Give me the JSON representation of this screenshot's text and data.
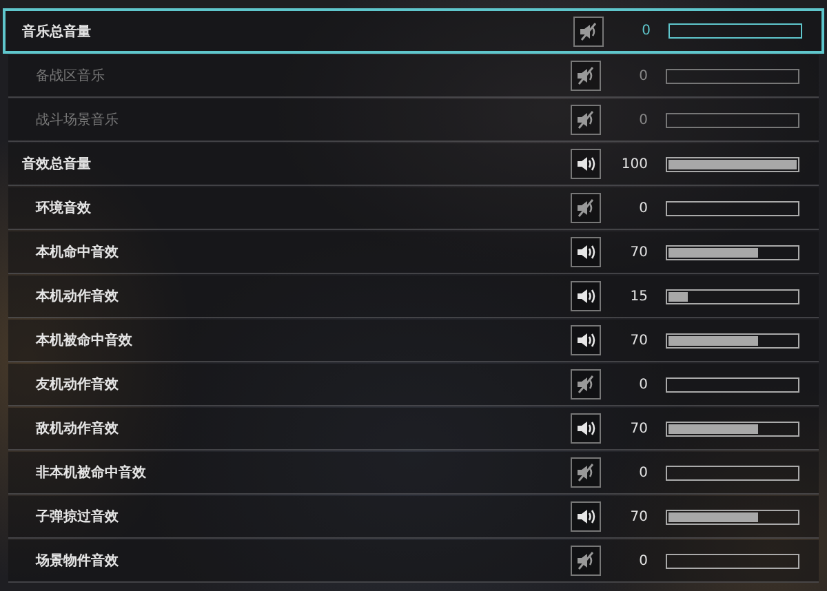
{
  "groups": [
    {
      "name": "音乐总音量",
      "reading": "0",
      "muted": true,
      "disabled": false,
      "selected": true,
      "children": [
        {
          "name": "备战区音乐",
          "reading": "0",
          "muted": true,
          "disabled": true,
          "selected": false
        },
        {
          "name": "战斗场景音乐",
          "reading": "0",
          "muted": true,
          "disabled": true,
          "selected": false
        }
      ]
    },
    {
      "name": "音效总音量",
      "reading": "100",
      "level": 1,
      "muted": false,
      "disabled": false,
      "selected": false,
      "children": [
        {
          "name": "环境音效",
          "reading": "0",
          "muted": true,
          "disabled": false,
          "selected": false
        },
        {
          "name": "本机命中音效",
          "reading": "70",
          "level": 0.7,
          "muted": false,
          "disabled": false,
          "selected": false
        },
        {
          "name": "本机动作音效",
          "reading": "15",
          "level": 0.15,
          "muted": false,
          "disabled": false,
          "selected": false
        },
        {
          "name": "本机被命中音效",
          "reading": "70",
          "level": 0.7,
          "muted": false,
          "disabled": false,
          "selected": false
        },
        {
          "name": "友机动作音效",
          "reading": "0",
          "muted": true,
          "disabled": false,
          "selected": false
        },
        {
          "name": "敌机动作音效",
          "reading": "70",
          "level": 0.7,
          "muted": false,
          "disabled": false,
          "selected": false
        },
        {
          "name": "非本机被命中音效",
          "reading": "0",
          "muted": true,
          "disabled": false,
          "selected": false
        },
        {
          "name": "子弹掠过音效",
          "reading": "70",
          "level": 0.7,
          "muted": false,
          "disabled": false,
          "selected": false
        },
        {
          "name": "场景物件音效",
          "reading": "0",
          "muted": true,
          "disabled": false,
          "selected": false
        }
      ]
    }
  ]
}
